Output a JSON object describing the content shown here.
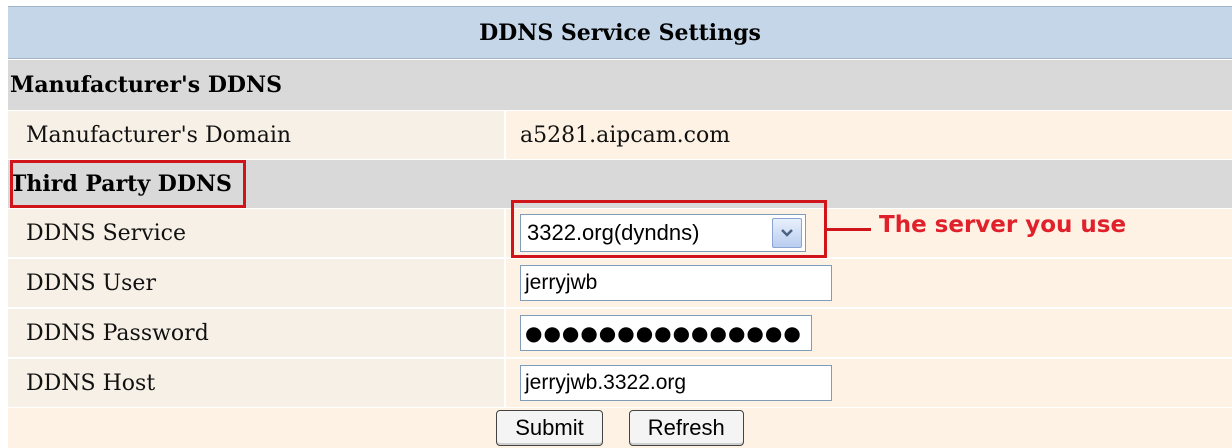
{
  "panel": {
    "title": "DDNS Service Settings"
  },
  "manufacturer_section": {
    "heading": "Manufacturer's DDNS",
    "domain_label": "Manufacturer's Domain",
    "domain_value": "a5281.aipcam.com"
  },
  "third_party_section": {
    "heading": "Third Party DDNS",
    "service_label": "DDNS Service",
    "service_selected": "3322.org(dyndns)",
    "user_label": "DDNS User",
    "user_value": "jerryjwb",
    "password_label": "DDNS Password",
    "password_mask": "●●●●●●●●●●●●●●●",
    "host_label": "DDNS Host",
    "host_value": "jerryjwb.3322.org"
  },
  "buttons": {
    "submit": "Submit",
    "refresh": "Refresh"
  },
  "annotation": {
    "text": "The server you use",
    "color": "#d1131a"
  },
  "icons": {
    "dropdown": "chevron-down-icon"
  }
}
